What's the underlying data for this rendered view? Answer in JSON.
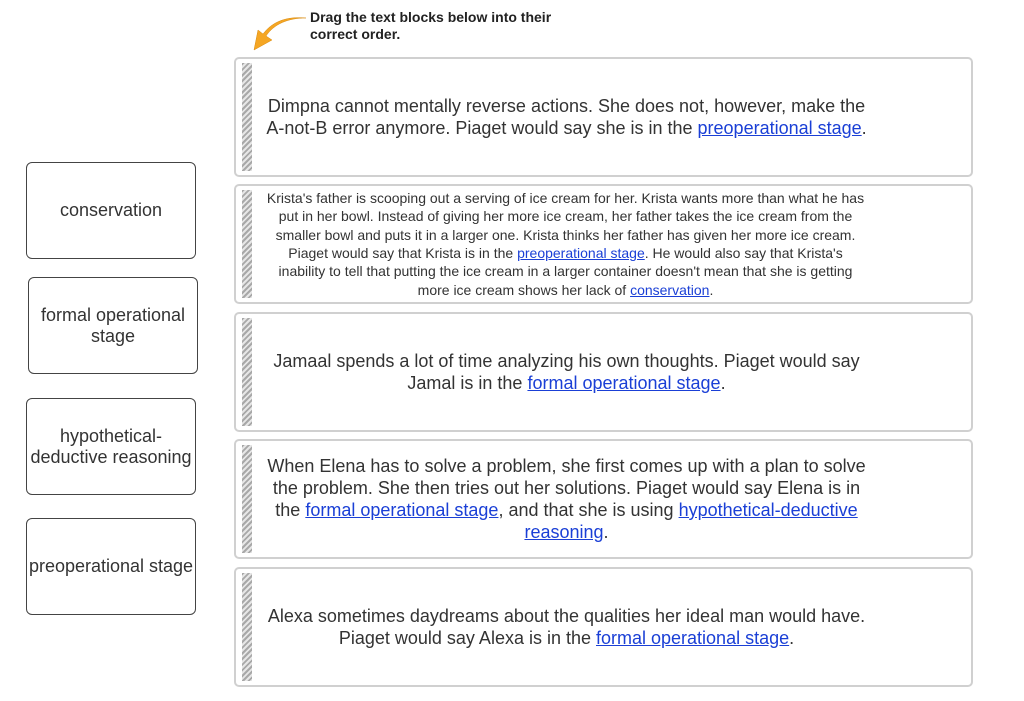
{
  "instructions": "Drag the text blocks below into their correct order.",
  "answer_options": [
    {
      "label": "conservation"
    },
    {
      "label": "formal operational stage"
    },
    {
      "label": "hypothetical-deductive reasoning"
    },
    {
      "label": "preoperational stage"
    }
  ],
  "blocks": [
    {
      "pre": "Dimpna cannot mentally reverse actions. She does not, however, make the A-not-B error anymore. Piaget would say she is in the ",
      "link1": "preoperational stage",
      "mid": ".",
      "link2": "",
      "post": ""
    },
    {
      "pre": "Krista's father is scooping out a serving of ice cream for her. Krista wants more than what he has put in her bowl. Instead of giving her more ice cream, her father takes the ice cream from the smaller bowl and puts it in a larger one. Krista thinks her father has given her more ice cream. Piaget would say that Krista is in the ",
      "link1": "preoperational stage",
      "mid": ". He would also say that Krista's inability to tell that putting the ice cream in a larger container doesn't mean that she is getting more ice cream shows her lack of ",
      "link2": "conservation",
      "post": "."
    },
    {
      "pre": "Jamaal spends a lot of time analyzing his own thoughts. Piaget would say Jamal is in the ",
      "link1": "formal operational stage",
      "mid": ".",
      "link2": "",
      "post": ""
    },
    {
      "pre": "When Elena has to solve a problem, she first comes up with a plan to solve the problem. She then tries out her solutions. Piaget would say Elena is in the ",
      "link1": "formal operational stage",
      "mid": ", and that she is using ",
      "link2": "hypothetical-deductive reasoning",
      "post": "."
    },
    {
      "pre": "Alexa sometimes daydreams about the qualities her ideal man would have. Piaget would say Alexa is in the ",
      "link1": "formal operational stage",
      "mid": ".",
      "link2": "",
      "post": ""
    }
  ],
  "colors": {
    "link": "#1a3fd6",
    "arrow": "#f5a623",
    "block_border": "#d0d0d0"
  }
}
